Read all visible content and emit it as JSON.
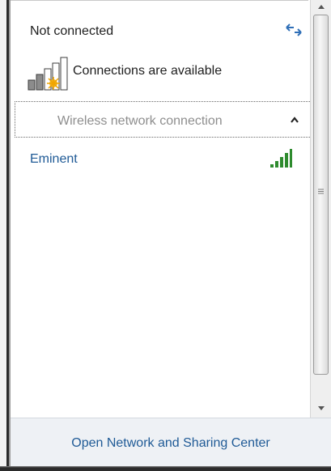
{
  "status": {
    "title": "Not connected",
    "availability_text": "Connections are available",
    "refresh_icon": "refresh-arrows-icon",
    "availability_icon": "network-available-icon"
  },
  "section": {
    "label": "Wireless network connection",
    "expanded": true,
    "toggle_icon": "chevron-up-icon"
  },
  "networks": [
    {
      "name": "Eminent",
      "signal_icon": "wifi-signal-icon",
      "signal_bars": 5
    }
  ],
  "footer": {
    "link_label": "Open Network and Sharing Center"
  },
  "colors": {
    "link": "#1f5a96",
    "section_label": "#8e8e8e",
    "signal_green": "#2e8b2e",
    "footer_bg": "#eef1f5"
  }
}
